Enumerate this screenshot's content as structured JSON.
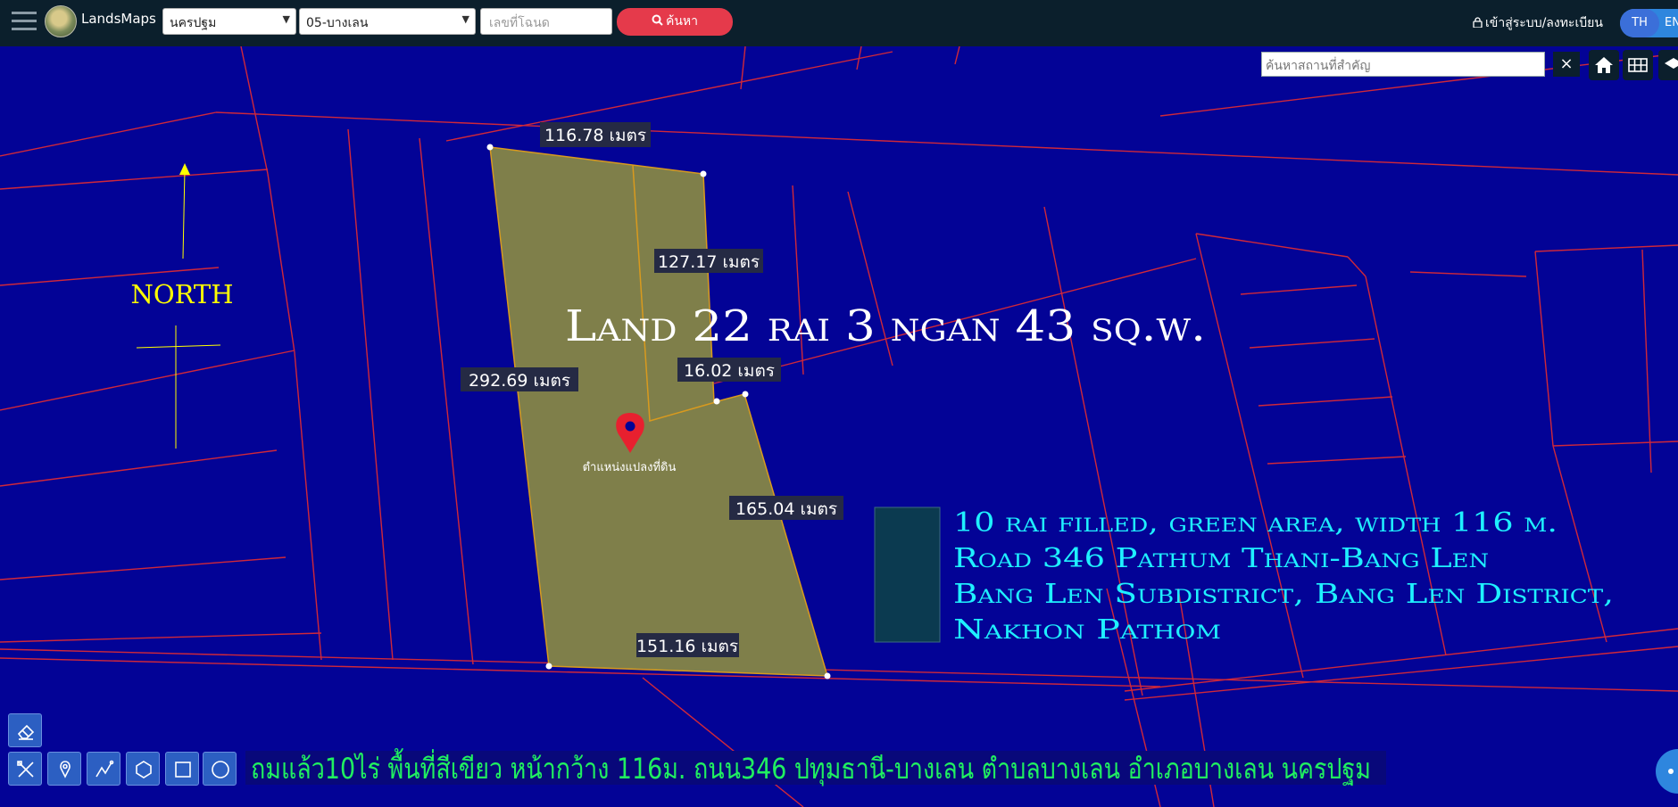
{
  "app": {
    "brand": "LandsMaps"
  },
  "header": {
    "province_select": "นครปฐม",
    "district_select": "05-บางเลน",
    "deed_placeholder": "เลขที่โฉนด",
    "search_button": "ค้นหา",
    "login_link": "เข้าสู่ระบบ/ลงทะเบียน",
    "lang_th": "TH",
    "lang_en": "EN"
  },
  "map_tools": {
    "place_search_placeholder": "ค้นหาสถานที่สำคัญ",
    "close_symbol": "×"
  },
  "map": {
    "title": "Land 22 rai 3 ngan 43 sq.w.",
    "north_label": "NORTH",
    "marker_label": "ตำแหน่งแปลงที่ดิน",
    "measurements": {
      "top": "116.78 เมตร",
      "inner_right": "127.17 เมตร",
      "left": "292.69 เมตร",
      "step": "16.02 เมตร",
      "right": "165.04 เมตร",
      "bottom": "151.16 เมตร"
    },
    "info_lines": [
      "10 rai filled, green area, width 116 m.",
      "Road 346 Pathum Thani-Bang Len",
      "Bang Len Subdistrict, Bang Len District,",
      "Nakhon Pathom"
    ],
    "thai_caption": "ถมแล้ว10ไร่ พื้นที่สีเขียว หน้ากว้าง 116ม. ถนน346 ปทุมธานี-บางเลน ตำบลบางเลน อำเภอบางเลน นครปฐม",
    "colors": {
      "background": "#030396",
      "parcel_lines": "#d0283a",
      "plot_fill": "#7f7f4a",
      "plot_edge": "#d99a1e",
      "label_bg": "#252a44",
      "info_text": "#1ff0ff",
      "caption_text": "#20f060",
      "north": "#ffff00",
      "legend_swatch": "#0b3a50"
    }
  }
}
